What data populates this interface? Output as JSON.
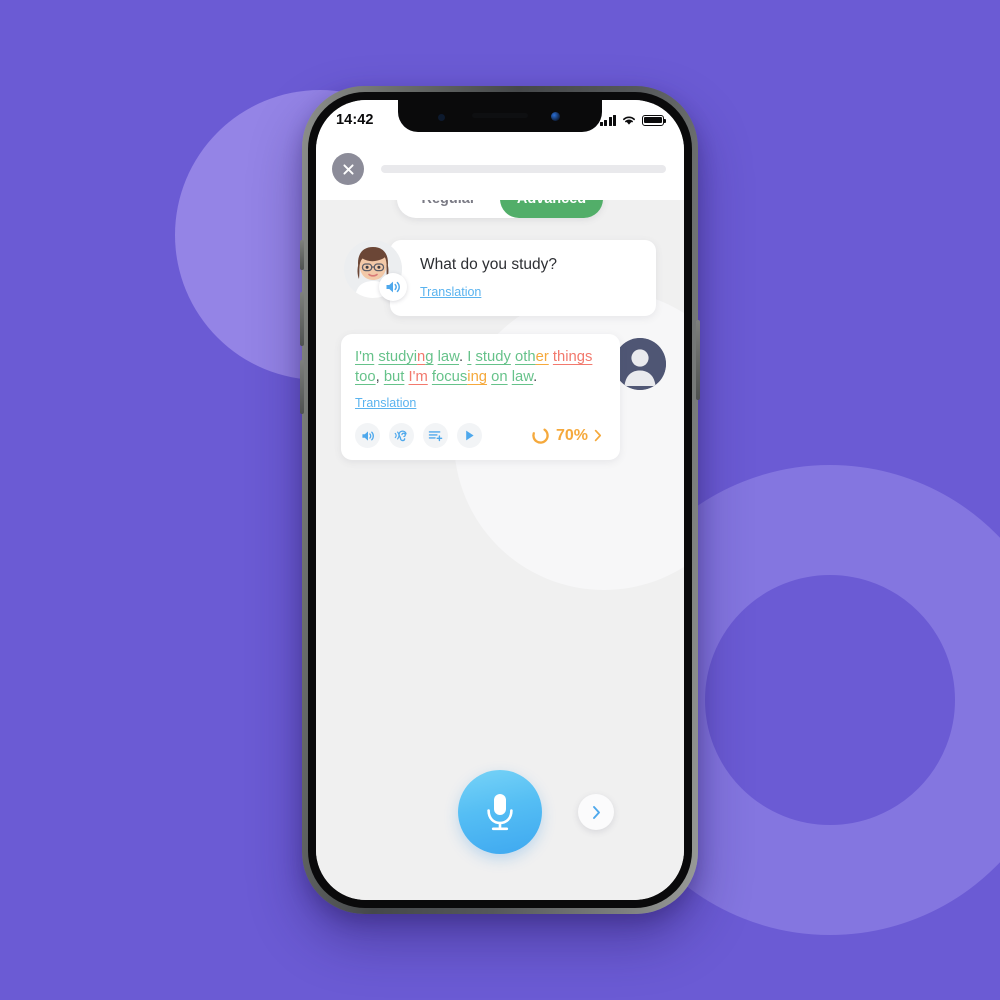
{
  "theme": {
    "background_purple": "#6B5BD4",
    "deco_purple_light": "#9484E6",
    "accent_green": "#52AE69",
    "accent_blue": "#55bef4",
    "accent_orange": "#f5a93c",
    "link_blue": "#5ab3ef"
  },
  "status_bar": {
    "time": "14:42",
    "signal_icon": "cellular-signal-icon",
    "wifi_icon": "wifi-icon",
    "battery_icon": "battery-full-icon"
  },
  "header": {
    "close_icon": "close-icon",
    "progress_bar_name": "lesson-progress-bar",
    "progress_value": 0
  },
  "tabs": [
    {
      "label": "Regular",
      "active": false
    },
    {
      "label": "Advanced",
      "active": true
    }
  ],
  "bot_message": {
    "avatar_name": "tutor-avatar",
    "speaker_icon": "speaker-icon",
    "text": "What do you study?",
    "translation_label": "Translation"
  },
  "user_message": {
    "avatar_name": "user-avatar",
    "translation_label": "Translation",
    "tokens": [
      {
        "t": "I'm",
        "color": "green",
        "underline": true
      },
      {
        "t": " ",
        "color": "plain",
        "underline": false
      },
      {
        "t": "studyi",
        "color": "green",
        "underline": true
      },
      {
        "t": "n",
        "color": "red",
        "underline": true
      },
      {
        "t": "g",
        "color": "green",
        "underline": true
      },
      {
        "t": " ",
        "color": "plain",
        "underline": false
      },
      {
        "t": "law",
        "color": "green",
        "underline": true
      },
      {
        "t": ". ",
        "color": "plain",
        "underline": false
      },
      {
        "t": "I",
        "color": "green",
        "underline": true
      },
      {
        "t": " ",
        "color": "plain",
        "underline": false
      },
      {
        "t": "study",
        "color": "green",
        "underline": true
      },
      {
        "t": " ",
        "color": "plain",
        "underline": false
      },
      {
        "t": "oth",
        "color": "green",
        "underline": true
      },
      {
        "t": "er",
        "color": "orange",
        "underline": true
      },
      {
        "t": " ",
        "color": "plain",
        "underline": false
      },
      {
        "t": "things",
        "color": "red",
        "underline": true
      },
      {
        "t": " ",
        "color": "plain",
        "underline": false
      },
      {
        "t": "too",
        "color": "green",
        "underline": true
      },
      {
        "t": ", ",
        "color": "plain",
        "underline": false
      },
      {
        "t": "but",
        "color": "green",
        "underline": true
      },
      {
        "t": " ",
        "color": "plain",
        "underline": false
      },
      {
        "t": "I'm",
        "color": "red",
        "underline": true
      },
      {
        "t": " ",
        "color": "plain",
        "underline": false
      },
      {
        "t": "focus",
        "color": "green",
        "underline": true
      },
      {
        "t": "ing",
        "color": "orange",
        "underline": true
      },
      {
        "t": " ",
        "color": "plain",
        "underline": false
      },
      {
        "t": "on",
        "color": "green",
        "underline": true
      },
      {
        "t": " ",
        "color": "plain",
        "underline": false
      },
      {
        "t": "law",
        "color": "green",
        "underline": true
      },
      {
        "t": ".",
        "color": "plain",
        "underline": false
      }
    ],
    "actions": [
      {
        "name": "speaker-icon",
        "title": "Listen"
      },
      {
        "name": "ear-listen-icon",
        "title": "Slow listen"
      },
      {
        "name": "add-to-list-icon",
        "title": "Add to list"
      },
      {
        "name": "play-icon",
        "title": "Play recording"
      }
    ],
    "score": {
      "value": "70%",
      "percent": 70,
      "ring_icon": "progress-ring-icon",
      "chevron_icon": "chevron-right-icon"
    }
  },
  "bottom_bar": {
    "mic_button_name": "microphone-record-button",
    "mic_icon": "microphone-icon",
    "next_button_name": "next-button",
    "next_icon": "chevron-right-icon"
  }
}
